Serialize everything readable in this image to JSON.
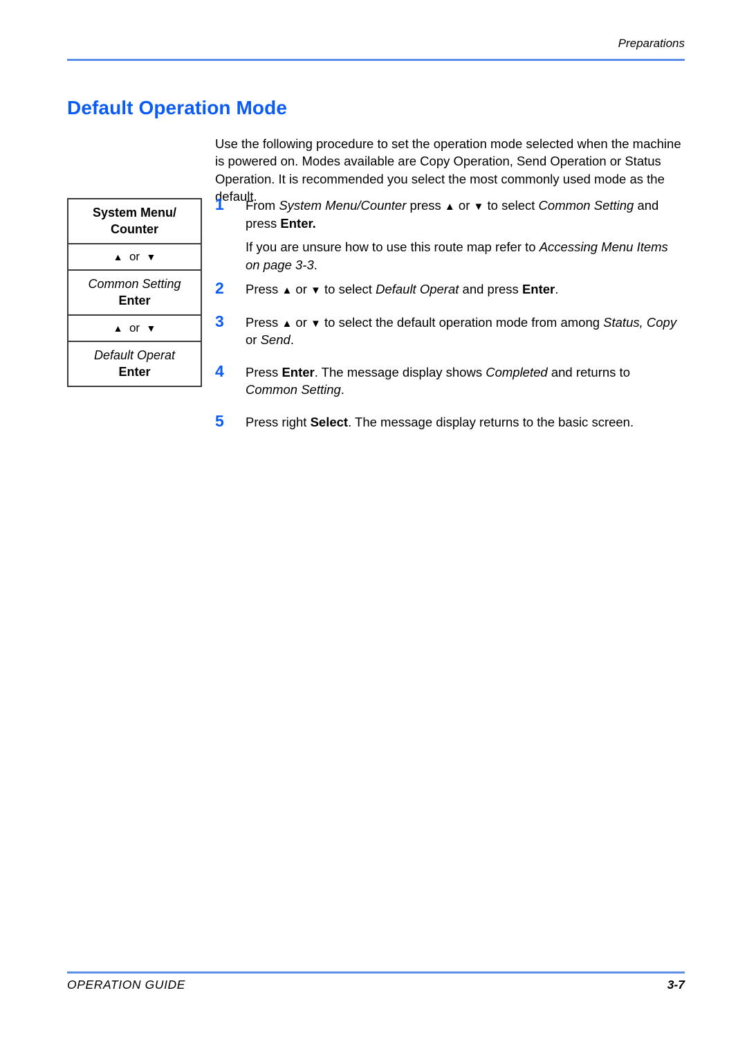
{
  "header": {
    "running_head": "Preparations",
    "rule_color": "#5C8EE8"
  },
  "section": {
    "title": "Default Operation Mode",
    "title_color": "#0B5BF5"
  },
  "intro": {
    "paragraph": "Use the following procedure to set the operation mode selected when the machine is powered on. Modes available are Copy Operation, Send Operation or Status Operation. It is recommended you select the most commonly used mode as the default."
  },
  "route_map": {
    "cells": [
      {
        "line1": "System Menu/",
        "line2": "Counter"
      },
      {
        "line1": "▲ or ▼"
      },
      {
        "line1": "Common Setting",
        "line2": "Enter"
      },
      {
        "line1": "▲ or ▼"
      },
      {
        "line1": "Default Operat",
        "line2": "Enter"
      }
    ],
    "labels": {
      "system_menu": "System Menu/",
      "counter": "Counter",
      "arrow_row": "▲ or ▼",
      "common_setting": "Common Setting",
      "enter_1": "Enter",
      "default_operat": "Default Operat",
      "enter_2": "Enter",
      "or": "or",
      "up_arrow": "▲",
      "down_arrow": "▼"
    }
  },
  "steps": [
    {
      "number": "1",
      "p1_a": "From ",
      "p1_b": "System Menu/Counter",
      "p1_c": " press ",
      "p1_d": "▲",
      "p1_e": " or ",
      "p1_f": "▼",
      "p1_g": " to select ",
      "p1_h": "Common Setting",
      "p1_i": " and press ",
      "p1_j": "Enter.",
      "p2_a": "If you are unsure how to use this route map refer to ",
      "p2_b": "Accessing Menu Items on page 3-3",
      "p2_c": "."
    },
    {
      "number": "2",
      "p1_a": "Press ",
      "p1_b": "▲",
      "p1_c": " or ",
      "p1_d": "▼",
      "p1_e": " to select ",
      "p1_f": "Default Operat",
      "p1_g": " and press ",
      "p1_h": "Enter",
      "p1_i": "."
    },
    {
      "number": "3",
      "p1_a": "Press ",
      "p1_b": "▲",
      "p1_c": " or ",
      "p1_d": "▼",
      "p1_e": " to select the default operation mode from among ",
      "p1_f": "Status, Copy",
      "p1_g": " or ",
      "p1_h": "Send",
      "p1_i": "."
    },
    {
      "number": "4",
      "p1_a": "Press ",
      "p1_b": "Enter",
      "p1_c": ". The message display shows ",
      "p1_d": "Completed",
      "p1_e": " and returns to ",
      "p1_f": "Common Setting",
      "p1_g": "."
    },
    {
      "number": "5",
      "p1_a": "Press right ",
      "p1_b": "Select",
      "p1_c": ". The message display returns to the basic screen."
    }
  ],
  "footer": {
    "left": "OPERATION GUIDE",
    "right": "3-7"
  }
}
